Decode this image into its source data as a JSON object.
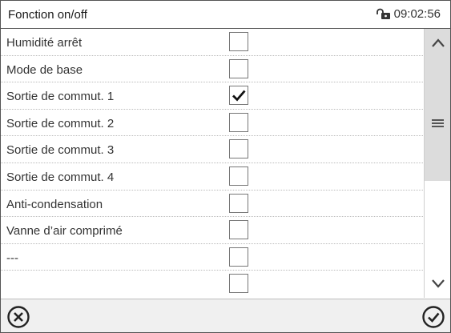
{
  "header": {
    "title": "Fonction on/off",
    "time": "09:02:56",
    "lock_icon": "unlocked-padlock-icon"
  },
  "rows": [
    {
      "label": "Humidité arrêt",
      "checked": false
    },
    {
      "label": "Mode de base",
      "checked": false
    },
    {
      "label": "Sortie de commut. 1",
      "checked": true
    },
    {
      "label": "Sortie de commut. 2",
      "checked": false
    },
    {
      "label": "Sortie de commut. 3",
      "checked": false
    },
    {
      "label": "Sortie de commut. 4",
      "checked": false
    },
    {
      "label": "Anti-condensation",
      "checked": false
    },
    {
      "label": "Vanne d’air comprimé",
      "checked": false
    },
    {
      "label": "---",
      "checked": false
    }
  ],
  "scrollbar": {
    "up_icon": "chevron-up-icon",
    "down_icon": "chevron-down-icon",
    "thumb_icon": "menu-lines-icon"
  },
  "footer": {
    "cancel_icon": "circle-x-icon",
    "confirm_icon": "circle-check-icon"
  },
  "colors": {
    "border": "#555555",
    "scroll_thumb": "#dcdcdc",
    "footer_bg": "#f0f0f0"
  }
}
